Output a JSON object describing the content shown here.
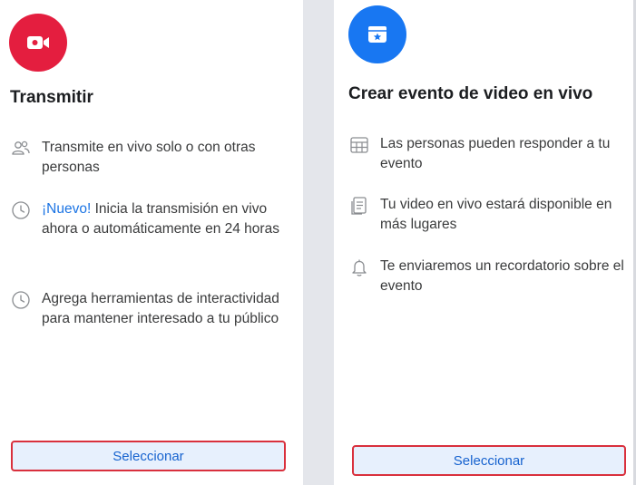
{
  "cards": [
    {
      "title": "Transmitir",
      "icon": "video-camera-icon",
      "icon_color": "#e41e3f",
      "features": [
        {
          "icon": "people-icon",
          "badge": "",
          "text": "Transmite en vivo solo o con otras personas"
        },
        {
          "icon": "clock-icon",
          "badge": "¡Nuevo!",
          "text": " Inicia la transmisión en vivo ahora o automáticamente en 24 horas"
        },
        {
          "icon": "clock-icon",
          "badge": "",
          "text": "Agrega herramientas de interactividad para mantener interesado a tu público"
        }
      ],
      "button_label": "Seleccionar"
    },
    {
      "title": "Crear evento de video en vivo",
      "icon": "calendar-star-icon",
      "icon_color": "#1877f2",
      "features": [
        {
          "icon": "calendar-grid-icon",
          "badge": "",
          "text": "Las personas pueden responder a tu evento"
        },
        {
          "icon": "document-icon",
          "badge": "",
          "text": "Tu video en vivo estará disponible en más lugares"
        },
        {
          "icon": "bell-icon",
          "badge": "",
          "text": "Te enviaremos un recordatorio sobre el evento"
        }
      ],
      "button_label": "Seleccionar"
    }
  ],
  "colors": {
    "new_badge": "#1b74e4",
    "button_border": "#d9303d",
    "button_bg": "#e7f0fd",
    "button_text": "#1763cf"
  }
}
